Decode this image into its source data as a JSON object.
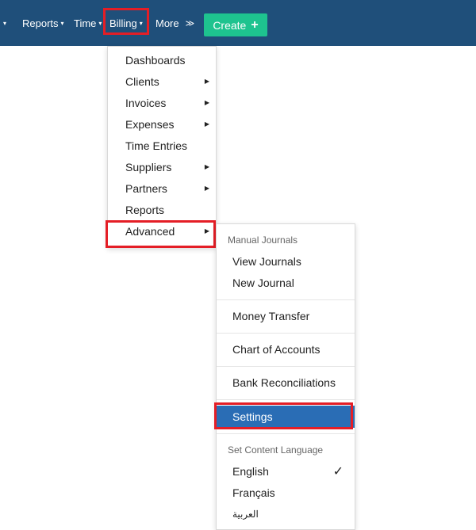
{
  "nav": {
    "partial_caret": "▾",
    "reports": "Reports",
    "time": "Time",
    "billing": "Billing",
    "more": "More",
    "more_chevron": "≫",
    "create": "Create",
    "create_plus": "+"
  },
  "billing_menu": {
    "items": [
      {
        "label": "Dashboards",
        "has_submenu": false
      },
      {
        "label": "Clients",
        "has_submenu": true
      },
      {
        "label": "Invoices",
        "has_submenu": true
      },
      {
        "label": "Expenses",
        "has_submenu": true
      },
      {
        "label": "Time Entries",
        "has_submenu": false
      },
      {
        "label": "Suppliers",
        "has_submenu": true
      },
      {
        "label": "Partners",
        "has_submenu": true
      },
      {
        "label": "Reports",
        "has_submenu": false
      },
      {
        "label": "Advanced",
        "has_submenu": true
      }
    ]
  },
  "advanced_menu": {
    "manual_journals_header": "Manual Journals",
    "view_journals": "View Journals",
    "new_journal": "New Journal",
    "money_transfer": "Money Transfer",
    "chart_of_accounts": "Chart of Accounts",
    "bank_reconciliations": "Bank Reconciliations",
    "settings": "Settings",
    "language_header": "Set Content Language",
    "english": "English",
    "francais": "Français",
    "arabic": "العربية",
    "selected_language": "English"
  },
  "colors": {
    "topbar": "#1f4f7a",
    "create_button": "#1ec38f",
    "highlight_selected": "#2a6db5",
    "annotation_border": "#e41e26"
  },
  "icons": {
    "submenu_arrow": "caret-right-icon",
    "dropdown_caret": "caret-down-icon",
    "more_chevron": "double-chevron-down-icon",
    "create_plus": "plus-icon",
    "check": "check-icon"
  }
}
